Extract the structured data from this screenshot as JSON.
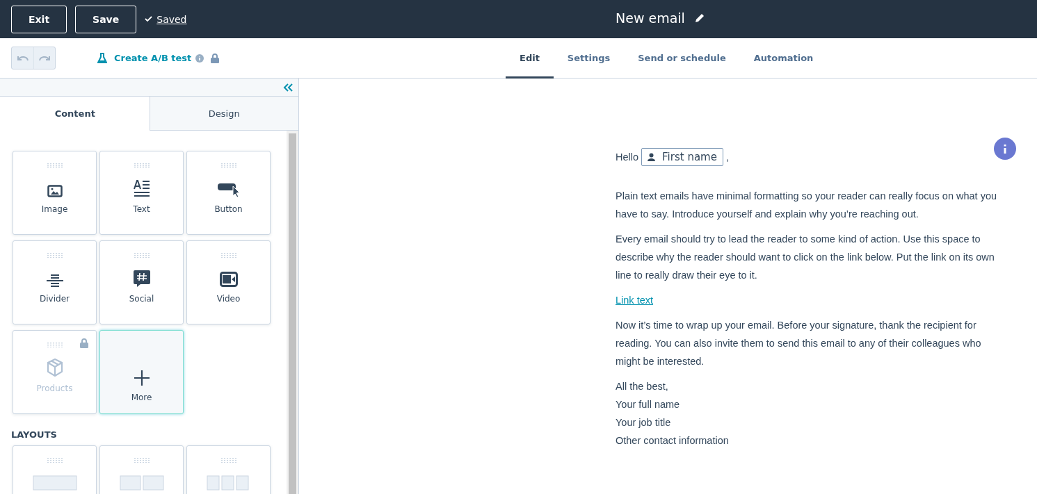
{
  "top_bar": {
    "buttons": [
      "Exit",
      "Save"
    ],
    "status": "Saved",
    "title": "New email"
  },
  "toolbar": {
    "undo": {
      "disabled": true
    },
    "redo": {
      "disabled": true
    },
    "ab_test": {
      "label": "Create A/B test",
      "locked": true
    }
  },
  "tabs": [
    {
      "label": "Edit",
      "selected": true
    },
    {
      "label": "Settings",
      "selected": false
    },
    {
      "label": "Send or schedule",
      "selected": false
    },
    {
      "label": "Automation",
      "selected": false
    }
  ],
  "sidebar": {
    "tabs": [
      {
        "label": "Content",
        "selected": true
      },
      {
        "label": "Design",
        "selected": false
      }
    ],
    "modules": [
      {
        "kind": "image",
        "label": "Image",
        "locked": false,
        "highlighted": false
      },
      {
        "kind": "text",
        "label": "Text",
        "locked": false,
        "highlighted": false
      },
      {
        "kind": "button",
        "label": "Button",
        "locked": false,
        "highlighted": false
      },
      {
        "kind": "divider",
        "label": "Divider",
        "locked": false,
        "highlighted": false
      },
      {
        "kind": "social",
        "label": "Social",
        "locked": false,
        "highlighted": false
      },
      {
        "kind": "video",
        "label": "Video",
        "locked": false,
        "highlighted": false
      },
      {
        "kind": "products",
        "label": "Products",
        "locked": true,
        "highlighted": false
      },
      {
        "kind": "more",
        "label": "More",
        "locked": false,
        "highlighted": true
      }
    ],
    "layouts_heading": "LAYOUTS",
    "layouts": [
      {
        "kind": "one-column"
      },
      {
        "kind": "two-column"
      },
      {
        "kind": "three-column"
      }
    ]
  },
  "email": {
    "greeting": "Hello",
    "token": "First name",
    "after_token": ",",
    "blocks": [
      {
        "kind": "paragraph",
        "text": "Plain text emails have minimal formatting so your reader can really focus on what you have to say. Introduce yourself and explain why you’re reaching out."
      },
      {
        "kind": "paragraph",
        "text": "Every email should try to lead the reader to some kind of action. Use this space to describe why the reader should want to click on the link below. Put the link on its own line to really draw their eye to it."
      },
      {
        "kind": "link",
        "text": "Link text"
      },
      {
        "kind": "paragraph",
        "text": "Now it’s time to wrap up your email. Before your signature, thank the recipient for reading. You can also invite them to send this email to any of their colleagues who might be interested."
      },
      {
        "kind": "signature",
        "lines": [
          "All the best,",
          "Your full name",
          "Your job title",
          "Other contact information"
        ]
      }
    ]
  }
}
